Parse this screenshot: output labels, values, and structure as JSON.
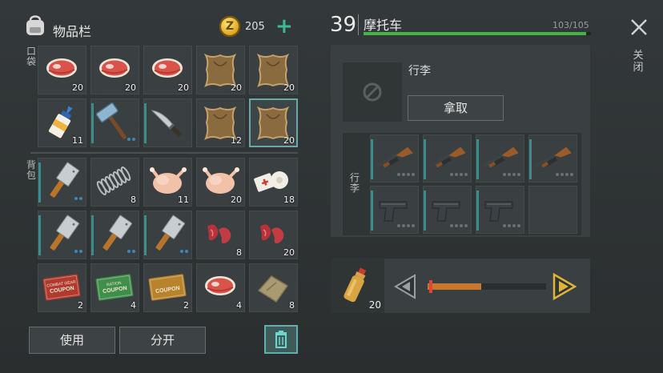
{
  "inventory": {
    "title": "物品栏",
    "coins": "205",
    "coin_symbol": "Z",
    "pocket_label": "口袋",
    "backpack_label": "背包",
    "pockets": [
      {
        "icon": "steak-icon",
        "count": "20"
      },
      {
        "icon": "steak-icon",
        "count": "20"
      },
      {
        "icon": "steak-icon",
        "count": "20"
      },
      {
        "icon": "leather-hide-icon",
        "count": "20"
      },
      {
        "icon": "leather-hide-icon",
        "count": "20"
      },
      {
        "icon": "glue-bottle-icon",
        "count": "11"
      },
      {
        "icon": "sledgehammer-icon",
        "count": "",
        "dots": 2,
        "bar": true
      },
      {
        "icon": "machete-icon",
        "count": "",
        "bar": true
      },
      {
        "icon": "leather-hide-icon",
        "count": "12"
      },
      {
        "icon": "leather-hide-icon",
        "count": "20",
        "selected": true
      }
    ],
    "backpack": [
      {
        "icon": "cleaver-icon",
        "count": "",
        "dots": 2,
        "bar": true
      },
      {
        "icon": "spring-icon",
        "count": "8"
      },
      {
        "icon": "raw-chicken-icon",
        "count": "11"
      },
      {
        "icon": "raw-chicken-icon",
        "count": "20"
      },
      {
        "icon": "bandage-icon",
        "count": "18"
      },
      {
        "icon": "cleaver-icon",
        "count": "",
        "dots": 2,
        "bar": true
      },
      {
        "icon": "cleaver-icon",
        "count": "",
        "dots": 2,
        "bar": true
      },
      {
        "icon": "cleaver-icon",
        "count": "",
        "dots": 2,
        "bar": true
      },
      {
        "icon": "raw-meat-strips-icon",
        "count": "8"
      },
      {
        "icon": "raw-meat-strips-icon",
        "count": "20"
      },
      {
        "icon": "combat-gear-coupon-icon",
        "count": "2",
        "coupon": {
          "color": "#b13a2e",
          "line1": "COMBAT GEAR",
          "line2": "COUPON"
        }
      },
      {
        "icon": "ration-coupon-icon",
        "count": "4",
        "coupon": {
          "color": "#3f8e4a",
          "line1": "RATION",
          "line2": "COUPON"
        }
      },
      {
        "icon": "coupon-icon",
        "count": "2",
        "coupon": {
          "color": "#b8832c",
          "line1": "",
          "line2": "COUPON"
        }
      },
      {
        "icon": "steak-icon",
        "count": "4"
      },
      {
        "icon": "cloth-bundle-icon",
        "count": "8"
      }
    ],
    "use_label": "使用",
    "split_label": "分开"
  },
  "vehicle": {
    "level": "39",
    "name": "摩托车",
    "durability": "103/105",
    "durability_fraction": 0.98,
    "luggage_label": "行李",
    "take_label": "拿取",
    "trunk_label": "行李",
    "trunk": [
      {
        "icon": "shotgun-icon",
        "bar": true,
        "dots": 4
      },
      {
        "icon": "shotgun-icon",
        "bar": true,
        "dots": 4
      },
      {
        "icon": "shotgun-icon",
        "bar": true,
        "dots": 4
      },
      {
        "icon": "shotgun-icon",
        "bar": true,
        "dots": 4
      },
      {
        "icon": "pistol-icon",
        "bar": true,
        "dots": 4
      },
      {
        "icon": "pistol-icon",
        "bar": true,
        "dots": 4
      },
      {
        "icon": "pistol-icon",
        "bar": true,
        "dots": 4
      },
      {
        "icon": "empty"
      }
    ]
  },
  "transfer": {
    "item": "fuel-bottle-icon",
    "count": "20",
    "fraction": 0.45
  },
  "close_label": "关闭",
  "colors": {
    "accent": "#3fb896",
    "durability": "#48b24a",
    "slider": "#c8772c",
    "arrow": "#e0b43a"
  }
}
